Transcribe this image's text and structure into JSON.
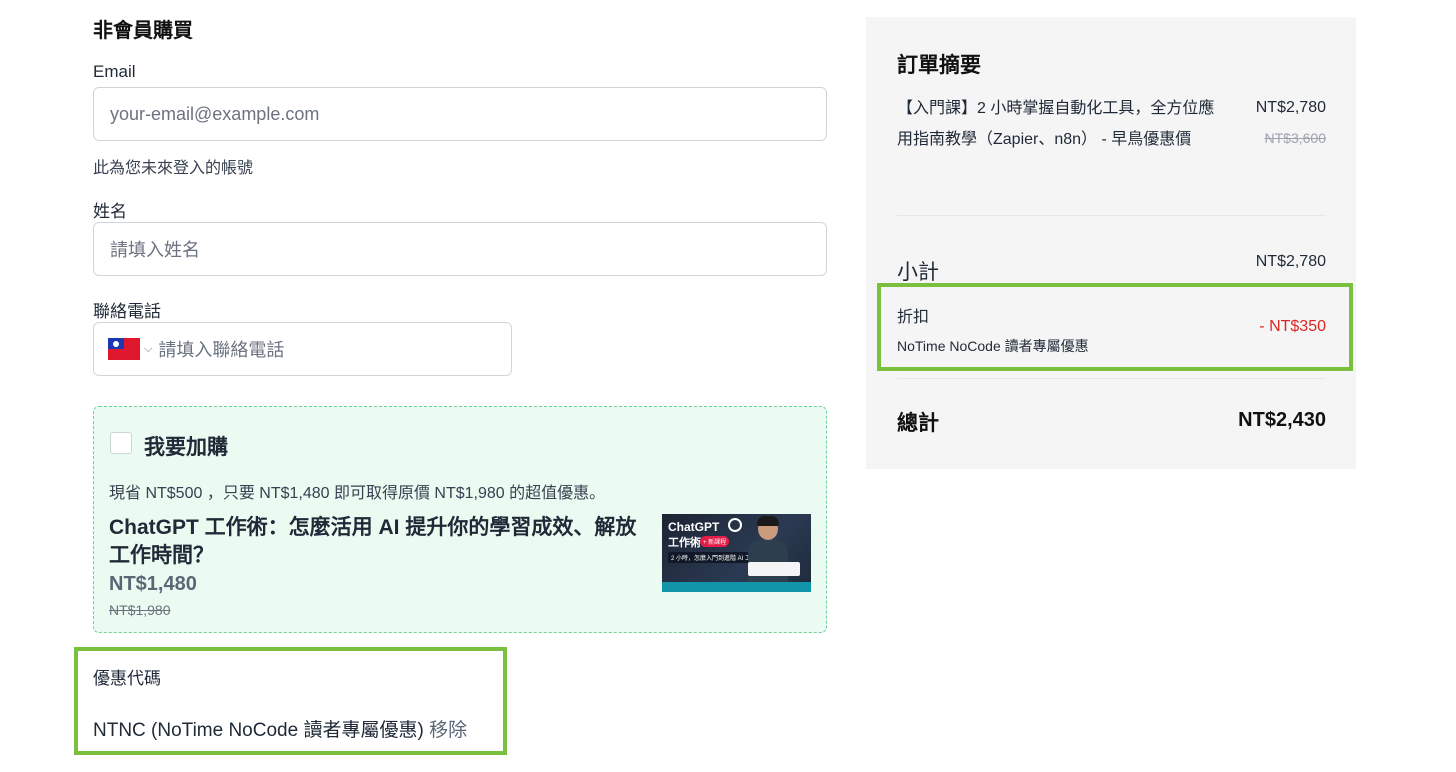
{
  "form": {
    "section_title": "非會員購買",
    "email": {
      "label": "Email",
      "placeholder": "your-email@example.com",
      "hint": "此為您未來登入的帳號"
    },
    "name": {
      "label": "姓名",
      "placeholder": "請填入姓名"
    },
    "phone": {
      "label": "聯絡電話",
      "placeholder": "請填入聯絡電話",
      "country_flag": "taiwan-flag-icon"
    }
  },
  "upsell": {
    "checkbox_label": "我要加購",
    "description": "現省 NT$500 ，只要 NT$1,480 即可取得原價 NT$1,980 的超值優惠。",
    "course_title": "ChatGPT 工作術：怎麼活用 AI 提升你的學習成效、解放工作時間？",
    "price": "NT$1,480",
    "original_price": "NT$1,980",
    "thumbnail": {
      "line1": "ChatGPT",
      "line2": "工作術",
      "badge": "+ 新課程",
      "tagline": "2 小時，怎麼入門到進階 AI 工具？"
    }
  },
  "coupon": {
    "label": "優惠代碼",
    "applied": "NTNC (NoTime NoCode 讀者專屬優惠)",
    "remove_label": "移除"
  },
  "summary": {
    "title": "訂單摘要",
    "item": {
      "name": "【入門課】2 小時掌握自動化工具，全方位應用指南教學（Zapier、n8n） - 早鳥優惠價",
      "price": "NT$2,780",
      "original_price": "NT$3,600"
    },
    "subtotal_label": "小計",
    "subtotal_value": "NT$2,780",
    "discount_label": "折扣",
    "discount_name": "NoTime NoCode 讀者專屬優惠",
    "discount_value": "- NT$350",
    "total_label": "總計",
    "total_value": "NT$2,430"
  },
  "colors": {
    "highlight_border": "#7bbf3f",
    "upsell_bg": "#ebfbf1",
    "upsell_border": "#6dd39a",
    "discount_red": "#dc2626",
    "summary_bg": "#f5f5f5"
  }
}
